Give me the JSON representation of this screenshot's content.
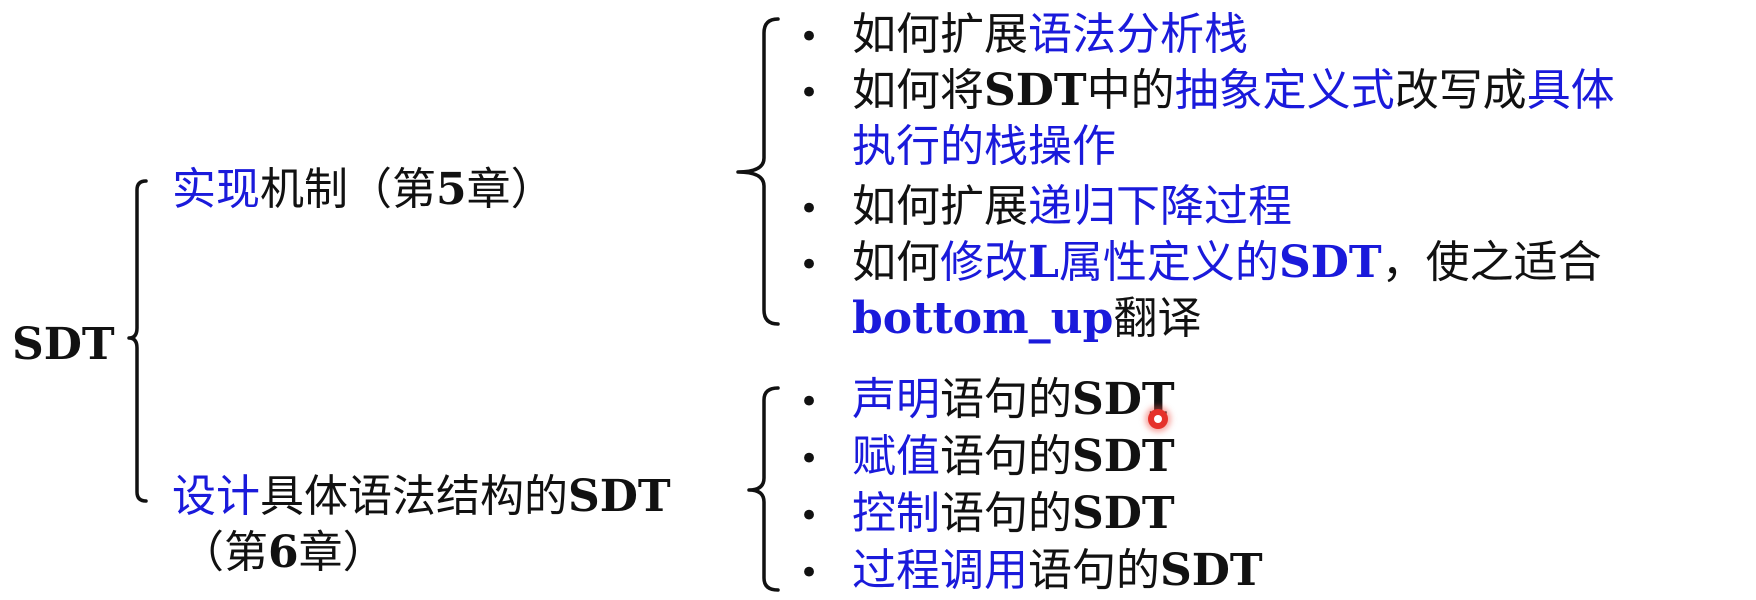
{
  "root": "SDT",
  "branch1": {
    "a": "实现",
    "b": "机制",
    "c": "（第",
    "d": "5",
    "e": "章）"
  },
  "branch2": {
    "a": "设计",
    "b": "具体语法结构的",
    "c": "SDT",
    "d": "（第",
    "e": "6",
    "f": "章）"
  },
  "list1": {
    "bullet": "•",
    "i1a": "如何扩展",
    "i1b": "语法分析栈",
    "i2a": "如何将",
    "i2b": "SDT",
    "i2c": "中的",
    "i2d": "抽象定义式",
    "i2e": "改写成",
    "i2f": "具体",
    "i2g": "执行的栈操作",
    "i3a": "如何扩展",
    "i3b": "递归下降过程",
    "i4a": "如何",
    "i4b": "修改",
    "i4c": "L",
    "i4d": "属性定义的",
    "i4e": "SDT",
    "i4f": "，使之适合",
    "i4g": "bottom_up",
    "i4h": "翻译"
  },
  "list2": {
    "i1a": "声明",
    "i1b": "语句的",
    "i1c": "SDT",
    "i2a": "赋值",
    "i2b": "语句的",
    "i2c": "SDT",
    "i3a": "控制",
    "i3b": "语句的",
    "i3c": "SDT",
    "i4a": "过程调用",
    "i4b": "语句的",
    "i4c": "SDT"
  },
  "colors": {
    "accent": "#1a1adb",
    "text": "#111111",
    "cursor": "#e5312a"
  }
}
